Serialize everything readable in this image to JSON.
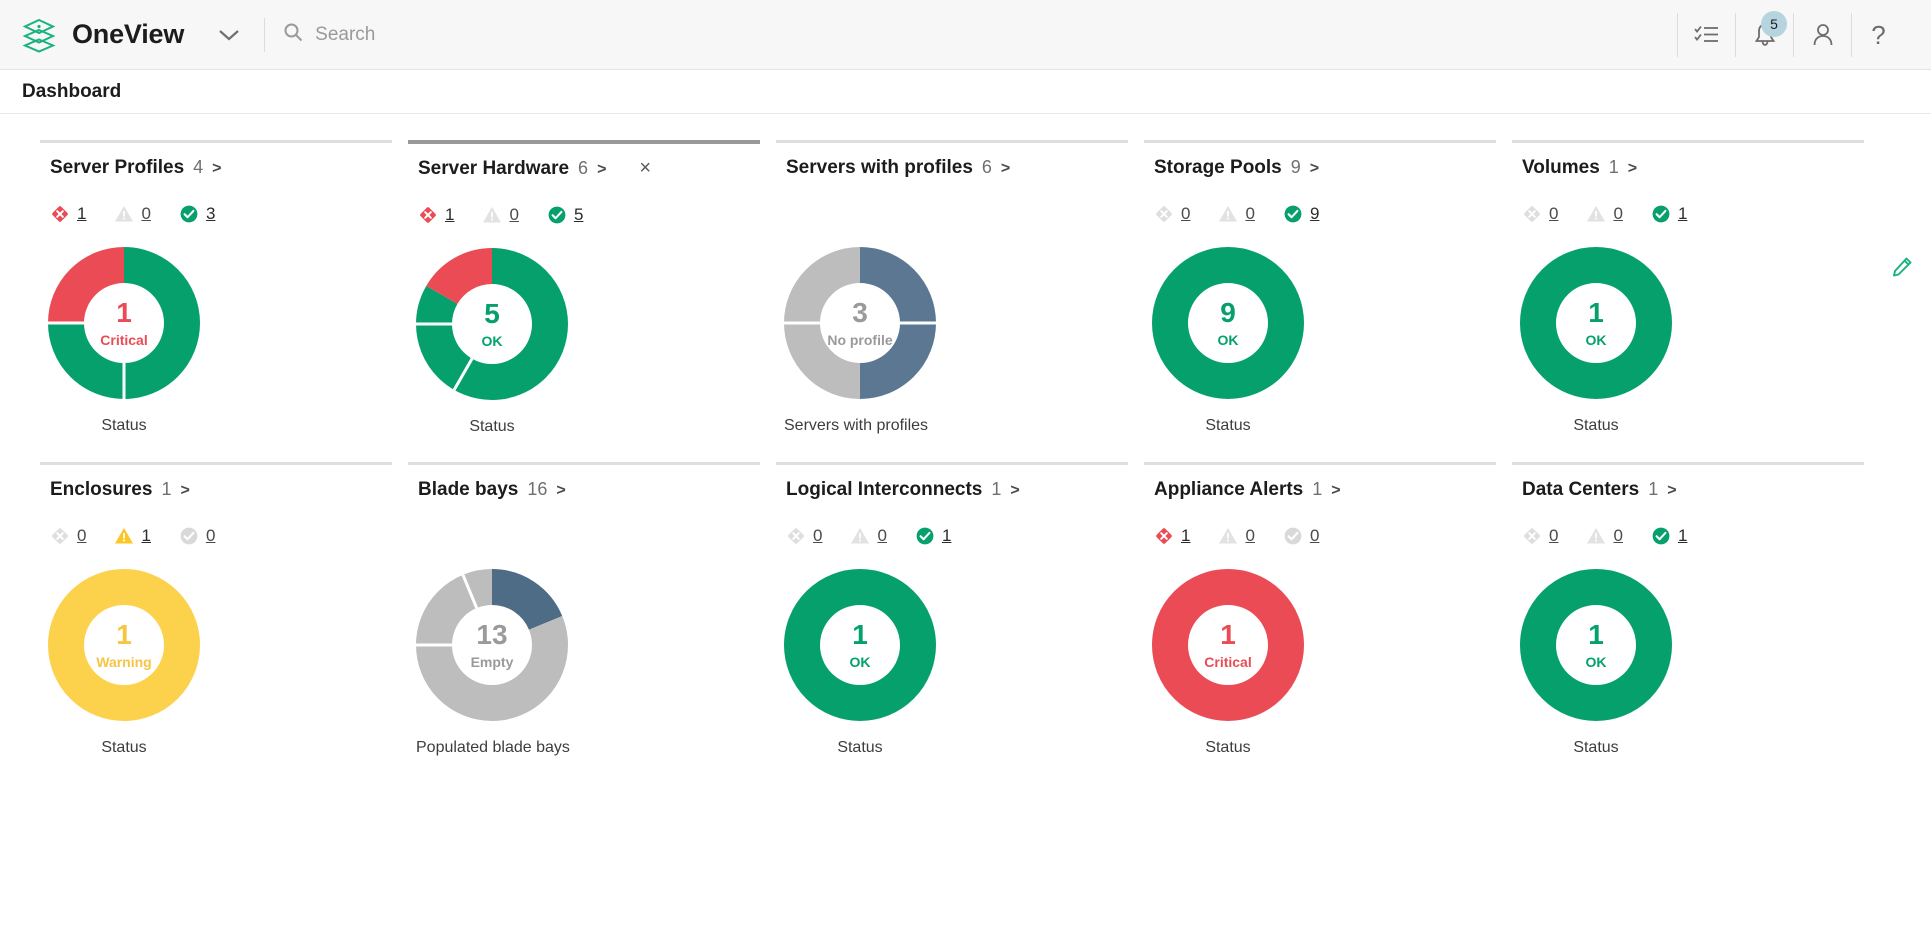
{
  "header": {
    "brand": "OneView",
    "logo_icon": "layers-icon",
    "dropdown_icon": "chevron-down-icon",
    "search": {
      "placeholder": "Search",
      "value": "",
      "icon": "search-icon"
    },
    "actions": [
      {
        "name": "activity-icon",
        "label": ""
      },
      {
        "name": "notifications-bell-icon",
        "badge": "5"
      },
      {
        "name": "user-account-icon",
        "label": ""
      },
      {
        "name": "help-icon",
        "label": "?"
      }
    ]
  },
  "page": {
    "title": "Dashboard",
    "edit_icon": "edit-pencil-icon"
  },
  "colors": {
    "ok_green": "#05a06b",
    "critical_red": "#ea4b54",
    "warning_yellow": "#fcd24d",
    "slate_blue": "#5c7792",
    "neutral_gray": "#bdbdbd",
    "muted_gray": "#d4d4d4",
    "brand_green": "#18b37c"
  },
  "cards": [
    {
      "title": "Server Profiles",
      "count": "4",
      "arrow": ">",
      "selected": false,
      "closable": false,
      "chips": [
        {
          "icon": "critical-icon",
          "state": "critical",
          "value": "1"
        },
        {
          "icon": "warning-icon",
          "state": "disabled",
          "value": "0"
        },
        {
          "icon": "ok-icon",
          "state": "ok",
          "value": "3"
        }
      ],
      "donut": {
        "center_number": "1",
        "center_label": "Critical",
        "center_color": "#ea4b54",
        "caption": "Status",
        "segments": [
          {
            "name": "ok",
            "color": "#05a06b",
            "percent": 75
          },
          {
            "name": "critical",
            "color": "#ea4b54",
            "percent": 25
          }
        ]
      }
    },
    {
      "title": "Server Hardware",
      "count": "6",
      "arrow": ">",
      "selected": true,
      "closable": true,
      "close_icon": "close-icon",
      "chips": [
        {
          "icon": "critical-icon",
          "state": "critical",
          "value": "1"
        },
        {
          "icon": "warning-icon",
          "state": "disabled",
          "value": "0"
        },
        {
          "icon": "ok-icon",
          "state": "ok",
          "value": "5"
        }
      ],
      "donut": {
        "center_number": "5",
        "center_label": "OK",
        "center_color": "#05a06b",
        "caption": "Status",
        "segments": [
          {
            "name": "ok",
            "color": "#05a06b",
            "percent": 83.3
          },
          {
            "name": "critical",
            "color": "#ea4b54",
            "percent": 16.7
          }
        ]
      }
    },
    {
      "title": "Servers with profiles",
      "count": "6",
      "arrow": ">",
      "selected": false,
      "closable": false,
      "chips": [],
      "donut": {
        "center_number": "3",
        "center_label": "No profile",
        "center_color": "#9a9a9a",
        "caption": "Servers with profiles",
        "segments": [
          {
            "name": "with-profile",
            "color": "#5c7792",
            "percent": 50
          },
          {
            "name": "no-profile",
            "color": "#bdbdbd",
            "percent": 50
          }
        ]
      }
    },
    {
      "title": "Storage Pools",
      "count": "9",
      "arrow": ">",
      "selected": false,
      "closable": false,
      "chips": [
        {
          "icon": "critical-icon",
          "state": "disabled",
          "value": "0"
        },
        {
          "icon": "warning-icon",
          "state": "disabled",
          "value": "0"
        },
        {
          "icon": "ok-icon",
          "state": "ok",
          "value": "9"
        }
      ],
      "donut": {
        "center_number": "9",
        "center_label": "OK",
        "center_color": "#05a06b",
        "caption": "Status",
        "segments": [
          {
            "name": "ok",
            "color": "#05a06b",
            "percent": 100
          }
        ]
      }
    },
    {
      "title": "Volumes",
      "count": "1",
      "arrow": ">",
      "selected": false,
      "closable": false,
      "chips": [
        {
          "icon": "critical-icon",
          "state": "disabled",
          "value": "0"
        },
        {
          "icon": "warning-icon",
          "state": "disabled",
          "value": "0"
        },
        {
          "icon": "ok-icon",
          "state": "ok",
          "value": "1"
        }
      ],
      "donut": {
        "center_number": "1",
        "center_label": "OK",
        "center_color": "#05a06b",
        "caption": "Status",
        "segments": [
          {
            "name": "ok",
            "color": "#05a06b",
            "percent": 100
          }
        ]
      }
    },
    {
      "title": "Enclosures",
      "count": "1",
      "arrow": ">",
      "selected": false,
      "closable": false,
      "chips": [
        {
          "icon": "critical-icon",
          "state": "disabled",
          "value": "0"
        },
        {
          "icon": "warning-icon",
          "state": "warning",
          "value": "1"
        },
        {
          "icon": "ok-icon",
          "state": "disabled",
          "value": "0"
        }
      ],
      "donut": {
        "center_number": "1",
        "center_label": "Warning",
        "center_color": "#f5c544",
        "caption": "Status",
        "segments": [
          {
            "name": "warning",
            "color": "#fcd24d",
            "percent": 100
          }
        ]
      }
    },
    {
      "title": "Blade bays",
      "count": "16",
      "arrow": ">",
      "selected": false,
      "closable": false,
      "chips": [],
      "donut": {
        "center_number": "13",
        "center_label": "Empty",
        "center_color": "#9a9a9a",
        "caption": "Populated blade bays",
        "segments": [
          {
            "name": "populated",
            "color": "#4e6c85",
            "percent": 18.75
          },
          {
            "name": "empty",
            "color": "#bdbdbd",
            "percent": 81.25
          }
        ]
      }
    },
    {
      "title": "Logical Interconnects",
      "count": "1",
      "arrow": ">",
      "selected": false,
      "closable": false,
      "chips": [
        {
          "icon": "critical-icon",
          "state": "disabled",
          "value": "0"
        },
        {
          "icon": "warning-icon",
          "state": "disabled",
          "value": "0"
        },
        {
          "icon": "ok-icon",
          "state": "ok",
          "value": "1"
        }
      ],
      "donut": {
        "center_number": "1",
        "center_label": "OK",
        "center_color": "#05a06b",
        "caption": "Status",
        "segments": [
          {
            "name": "ok",
            "color": "#05a06b",
            "percent": 100
          }
        ]
      }
    },
    {
      "title": "Appliance Alerts",
      "count": "1",
      "arrow": ">",
      "selected": false,
      "closable": false,
      "chips": [
        {
          "icon": "critical-icon",
          "state": "critical",
          "value": "1"
        },
        {
          "icon": "warning-icon",
          "state": "disabled",
          "value": "0"
        },
        {
          "icon": "ok-icon",
          "state": "disabled",
          "value": "0"
        }
      ],
      "donut": {
        "center_number": "1",
        "center_label": "Critical",
        "center_color": "#ea4b54",
        "caption": "Status",
        "segments": [
          {
            "name": "critical",
            "color": "#ea4b54",
            "percent": 100
          }
        ]
      }
    },
    {
      "title": "Data Centers",
      "count": "1",
      "arrow": ">",
      "selected": false,
      "closable": false,
      "chips": [
        {
          "icon": "critical-icon",
          "state": "disabled",
          "value": "0"
        },
        {
          "icon": "warning-icon",
          "state": "disabled",
          "value": "0"
        },
        {
          "icon": "ok-icon",
          "state": "ok",
          "value": "1"
        }
      ],
      "donut": {
        "center_number": "1",
        "center_label": "OK",
        "center_color": "#05a06b",
        "caption": "Status",
        "segments": [
          {
            "name": "ok",
            "color": "#05a06b",
            "percent": 100
          }
        ]
      }
    }
  ]
}
